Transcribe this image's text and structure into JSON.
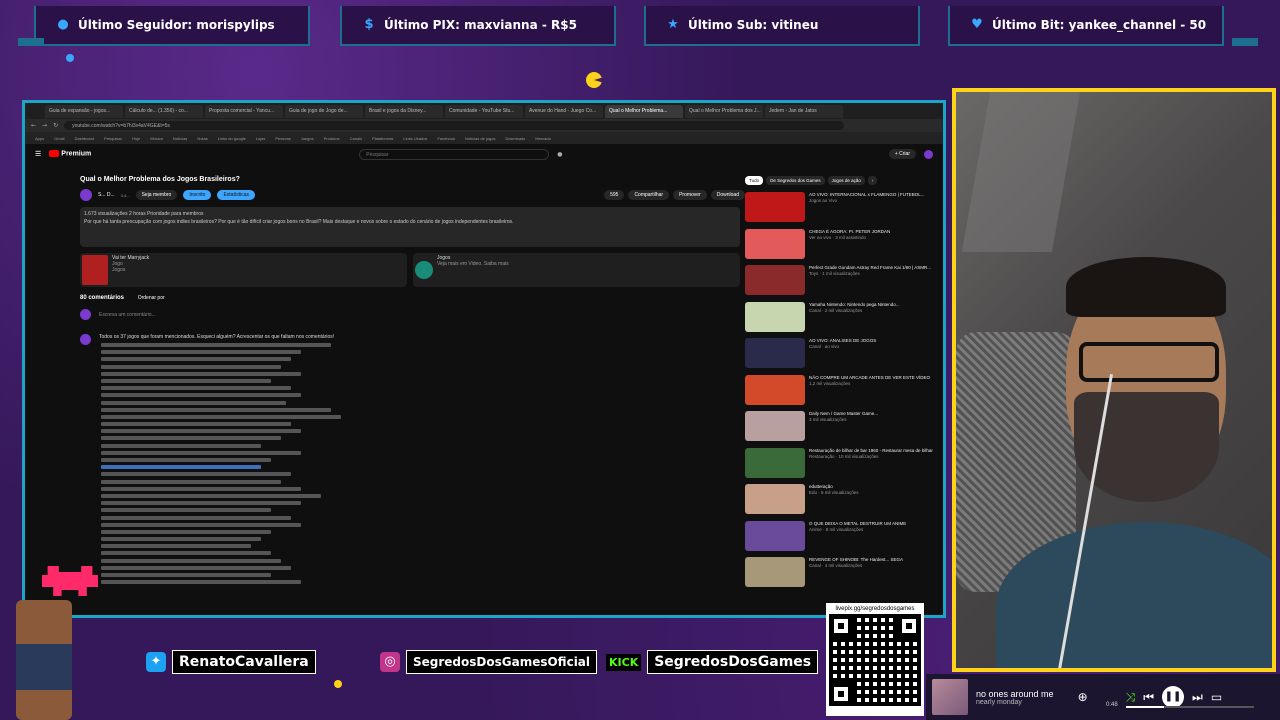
{
  "overlay": {
    "alerts": [
      {
        "label": "Último Seguidor: morispylips",
        "icon": "user-icon"
      },
      {
        "label": "Último PIX: maxvianna - R$5",
        "icon": "dollar-icon"
      },
      {
        "label": "Último Sub: vitineu",
        "icon": "star-icon"
      },
      {
        "label": "Último Bit: yankee_channel - 50",
        "icon": "diamond-icon"
      }
    ],
    "accent_color": "#1aa6c8",
    "cam_border_color": "#ffd21a"
  },
  "browser": {
    "tabs": [
      "Guia de expansão - jogos...",
      "Cálculo de... (1.356) - co...",
      "Proposta comercial - Yancu...",
      "Guia de jogo de Jogo de...",
      "Brasil e jogos da Disney...",
      "Comunidade - YouTube Stu...",
      "Avenue do Hand - Juego Co...",
      "Qual o Melhor Problema...",
      "Qual o Melhor Problema dos J...",
      "Jedem - Jan de Jatos"
    ],
    "url": "youtube.com/watch?v=b7hi3x4aV4GE&t=5s",
    "bookmarks": [
      "Apps",
      "Gmail",
      "Dashboard",
      "Pesquisar",
      "Hoje",
      "Música",
      "Notícias",
      "Notas",
      "Links do google",
      "Lojas",
      "Pessoas",
      "Juegos",
      "Produtos",
      "Canais",
      "Plataformas",
      "Links Usados",
      "Facebook",
      "Noticias de jogos",
      "Downloads",
      "Mercado"
    ]
  },
  "youtube": {
    "logo": "Premium",
    "search_placeholder": "Pesquisar",
    "create_label": "+ Criar",
    "video_title": "Qual o Melhor Problema dos Jogos Brasileiros?",
    "channel_name": "S... D...",
    "channel_subs": "3,4...",
    "join_label": "Seja membro",
    "subscribe_label": "Inscrito",
    "analytics_label": "Estatísticas",
    "like_count": "595",
    "share_label": "Compartilhar",
    "thanks_label": "Promover",
    "download_label": "Download",
    "description_stats": "1.673 visualizações  2 horas  Prioridade para membros",
    "description_text": "Por que há tanta preocupação com jogos indies brasileiros? Por que é tão difícil criar jogos bons no Brasil? Mais destaque e novos sobre o estado do cenário de jogos independentes brasileiros.",
    "card1_title": "Vai ter Marryjack",
    "card1_sub": "Jogo",
    "card1_link": "Jogos",
    "card2_title": "Jogos",
    "card2_sub": "Veja mais em Video. Saiba mais",
    "comments_count": "80 comentários",
    "sort_label": "Ordenar por",
    "add_comment": "Escreva um comentário...",
    "comment_intro": "Todos os 37 jogos que foram mencionados. Esqueci alguém? Acrescentar os que faltam nos comentários!"
  },
  "sidebar": {
    "chips": [
      "Tudo",
      "De Segredos dos Games",
      "Jogos de ação",
      "›"
    ],
    "recs": [
      {
        "title": "AO VIVO: INTERNACIONAL x FLAMENGO | FUTEBOL...",
        "sub": "Jogos ao Vivo",
        "color": "#c01818"
      },
      {
        "title": "CHEGA É AGORA: Pr. PETER JORDAN",
        "sub": "Ver ao vivo · 3 mil assistindo",
        "color": "#e35a5a"
      },
      {
        "title": "Perfect Grade Gundam Astray Red Frame Kai 1/60 | ASMR...",
        "sub": "Toys · 1 mil visualizações",
        "color": "#8a2a2a"
      },
      {
        "title": "Yamaha Nintendo: Nintendo pega Nintendo...",
        "sub": "Canal · 2 mil visualizações",
        "color": "#c8d6b0"
      },
      {
        "title": "AO VIVO: ANALISES DE JOGOS",
        "sub": "Canal · ao vivo",
        "color": "#2a2a4a"
      },
      {
        "title": "NÃO COMPRE UM ARCADE ANTES DE VER ESTE VÍDEO",
        "sub": "1,2 mil visualizações",
        "color": "#d24a2a"
      },
      {
        "title": "Daily Nem / Game Master Game...",
        "sub": "3 mil visualizações",
        "color": "#b8a0a0"
      },
      {
        "title": "Restauração de bilhar de bar 1960 - Restaurar mesa de bilhar",
        "sub": "Restauração · 10 mil visualizações",
        "color": "#3a6a3a"
      },
      {
        "title": "edutteração",
        "sub": "Edu · 5 mil visualizações",
        "color": "#c8a08a"
      },
      {
        "title": "O QUE DEIXA O METAL DESTRUIR UM ANIME",
        "sub": "Anime · 8 mil visualizações",
        "color": "#6a4a9a"
      },
      {
        "title": "REVENGE OF SHINOBI: The Hardest... SEGA",
        "sub": "Canal · 4 mil visualizações",
        "color": "#a8987a"
      }
    ]
  },
  "social": {
    "twitter": "RenatoCavallera",
    "instagram": "SegredosDosGamesOficial",
    "kick_brand": "KICK",
    "kick": "SegredosDosGames",
    "qr_label": "livepix.gg/segredosdosgames"
  },
  "player": {
    "title": "no ones around me",
    "artist": "nearly monday",
    "time": "0:48",
    "progress": 0.3
  }
}
